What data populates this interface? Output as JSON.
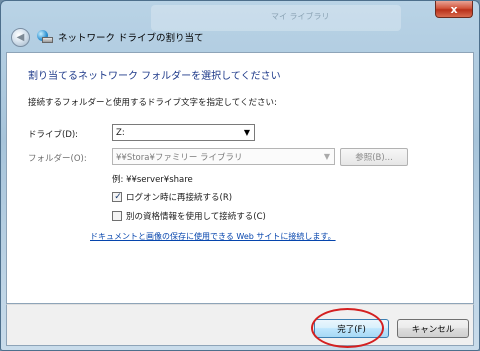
{
  "window": {
    "title": "ネットワーク ドライブの割り当て",
    "close_label": "x",
    "background_ghost": [
      "マイ ライブラリ"
    ]
  },
  "main": {
    "heading": "割り当てるネットワーク フォルダーを選択してください",
    "instruction": "接続するフォルダーと使用するドライブ文字を指定してください:",
    "drive_label": "ドライブ(D):",
    "drive_value": "Z:",
    "folder_label": "フォルダー(O):",
    "folder_value": "¥¥Stora¥ファミリー ライブラリ",
    "browse_label": "参照(B)...",
    "example": "例: ¥¥server¥share",
    "reconnect_label": "ログオン時に再接続する(R)",
    "reconnect_checked": true,
    "other_creds_label": "別の資格情報を使用して接続する(C)",
    "other_creds_checked": false,
    "link_text": "ドキュメントと画像の保存に使用できる Web サイトに接続します。"
  },
  "footer": {
    "finish_label": "完了(F)",
    "cancel_label": "キャンセル"
  },
  "colors": {
    "heading": "#1e3a8a",
    "link": "#0645ad",
    "annotation_ring": "#d42020"
  }
}
